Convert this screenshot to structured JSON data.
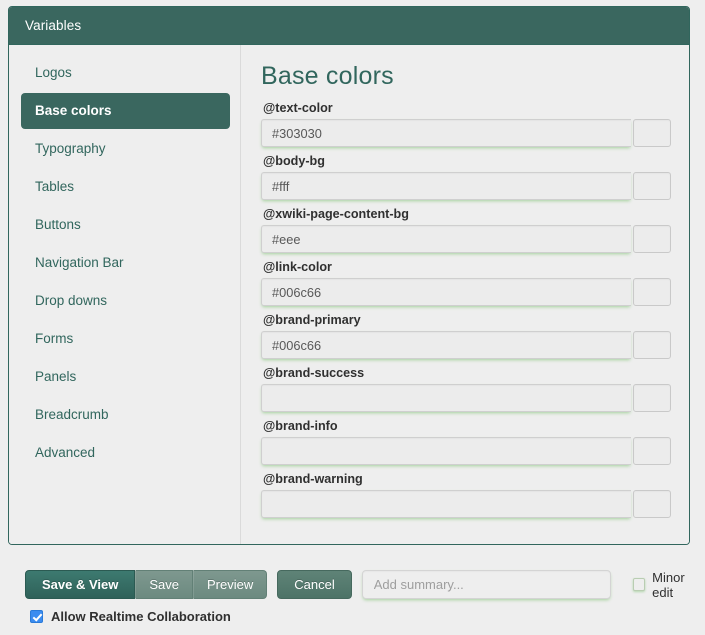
{
  "panel": {
    "title": "Variables"
  },
  "sidebar": {
    "items": [
      {
        "label": "Logos",
        "active": false
      },
      {
        "label": "Base colors",
        "active": true
      },
      {
        "label": "Typography",
        "active": false
      },
      {
        "label": "Tables",
        "active": false
      },
      {
        "label": "Buttons",
        "active": false
      },
      {
        "label": "Navigation Bar",
        "active": false
      },
      {
        "label": "Drop downs",
        "active": false
      },
      {
        "label": "Forms",
        "active": false
      },
      {
        "label": "Panels",
        "active": false
      },
      {
        "label": "Breadcrumb",
        "active": false
      },
      {
        "label": "Advanced",
        "active": false
      }
    ]
  },
  "content": {
    "title": "Base colors",
    "fields": [
      {
        "label": "@text-color",
        "value": "#303030"
      },
      {
        "label": "@body-bg",
        "value": "#fff"
      },
      {
        "label": "@xwiki-page-content-bg",
        "value": "#eee"
      },
      {
        "label": "@link-color",
        "value": "#006c66"
      },
      {
        "label": "@brand-primary",
        "value": "#006c66"
      },
      {
        "label": "@brand-success",
        "value": ""
      },
      {
        "label": "@brand-info",
        "value": ""
      },
      {
        "label": "@brand-warning",
        "value": ""
      }
    ]
  },
  "toolbar": {
    "save_and_view_label": "Save & View",
    "save_label": "Save",
    "preview_label": "Preview",
    "cancel_label": "Cancel",
    "summary_placeholder": "Add summary...",
    "summary_value": "",
    "minor_edit_label": "Minor edit",
    "minor_edit_checked": false,
    "realtime_label": "Allow Realtime Collaboration",
    "realtime_checked": true
  },
  "colors": {
    "header_bg": "#3a675f",
    "accent": "#31665d",
    "page_bg": "#eeeeee",
    "input_glow": "#8cc882",
    "checkbox_checked": "#3b8cf0"
  }
}
